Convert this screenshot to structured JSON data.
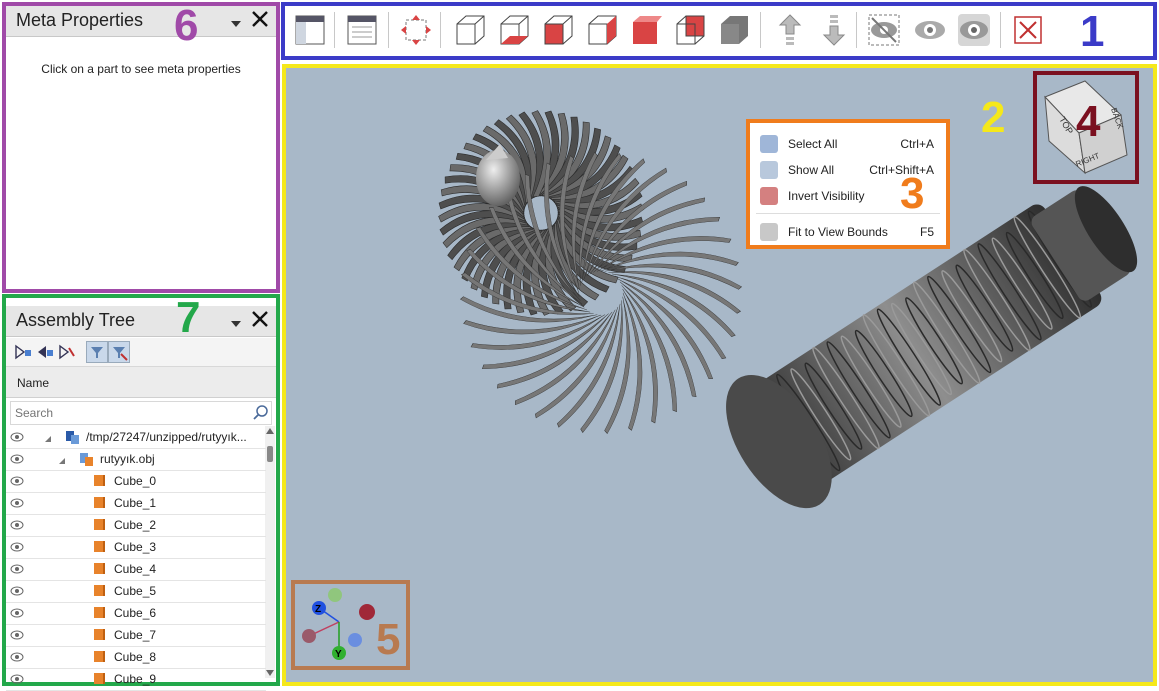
{
  "colors": {
    "toolbar_frame": "#3b3bc8",
    "viewport_frame": "#f5e81a",
    "menu_frame": "#f07c1c",
    "navcube_frame": "#7b1020",
    "axes_frame": "#b87a50",
    "meta_frame": "#a04aa8",
    "tree_frame": "#23a84a",
    "viewport_bg": "#a8b8c8",
    "num1": "#3b3bc8",
    "num2": "#f5e81a",
    "num3": "#f07c1c",
    "num4": "#7b1020",
    "num5": "#b87a50",
    "num6": "#a04aa8",
    "num7": "#23a84a"
  },
  "annotations": {
    "n1": "1",
    "n2": "2",
    "n3": "3",
    "n4": "4",
    "n5": "5",
    "n6": "6",
    "n7": "7"
  },
  "meta_panel": {
    "title": "Meta Properties",
    "empty_message": "Click on a part to see meta properties",
    "dropdown_icon": "chevron-down-icon",
    "close_icon": "close-icon"
  },
  "assembly_tree": {
    "title": "Assembly Tree",
    "column_header": "Name",
    "search_placeholder": "Search",
    "root_path": "/tmp/27247/unzipped/rutyyık...",
    "file_name": "rutyyık.obj",
    "items": [
      "Cube_0",
      "Cube_1",
      "Cube_2",
      "Cube_3",
      "Cube_4",
      "Cube_5",
      "Cube_6",
      "Cube_7",
      "Cube_8",
      "Cube_9"
    ]
  },
  "toolbar": {
    "buttons": [
      {
        "icon": "panel-left-icon"
      },
      {
        "icon": "panel-doc-icon"
      },
      {
        "icon": "fit-view-icon"
      },
      {
        "icon": "cube-front-icon"
      },
      {
        "icon": "cube-wire-icon"
      },
      {
        "icon": "cube-left-icon"
      },
      {
        "icon": "cube-right-icon"
      },
      {
        "icon": "cube-red-icon"
      },
      {
        "icon": "cube-back-icon"
      },
      {
        "icon": "cube-solid-icon"
      },
      {
        "icon": "explode-up-icon"
      },
      {
        "icon": "explode-down-icon"
      },
      {
        "icon": "hide-selected-icon"
      },
      {
        "icon": "show-icon"
      },
      {
        "icon": "show-all-icon"
      },
      {
        "icon": "close-x-icon"
      }
    ]
  },
  "context_menu": {
    "items": [
      {
        "label": "Select All",
        "shortcut": "Ctrl+A"
      },
      {
        "label": "Show All",
        "shortcut": "Ctrl+Shift+A"
      },
      {
        "label": "Invert Visibility",
        "shortcut": ""
      },
      {
        "label": "Fit to View Bounds",
        "shortcut": "F5"
      }
    ]
  },
  "nav_cube": {
    "top": "TOP",
    "back": "BACK",
    "right": "RIGHT"
  },
  "axes": {
    "z": "Z",
    "y": "Y"
  }
}
